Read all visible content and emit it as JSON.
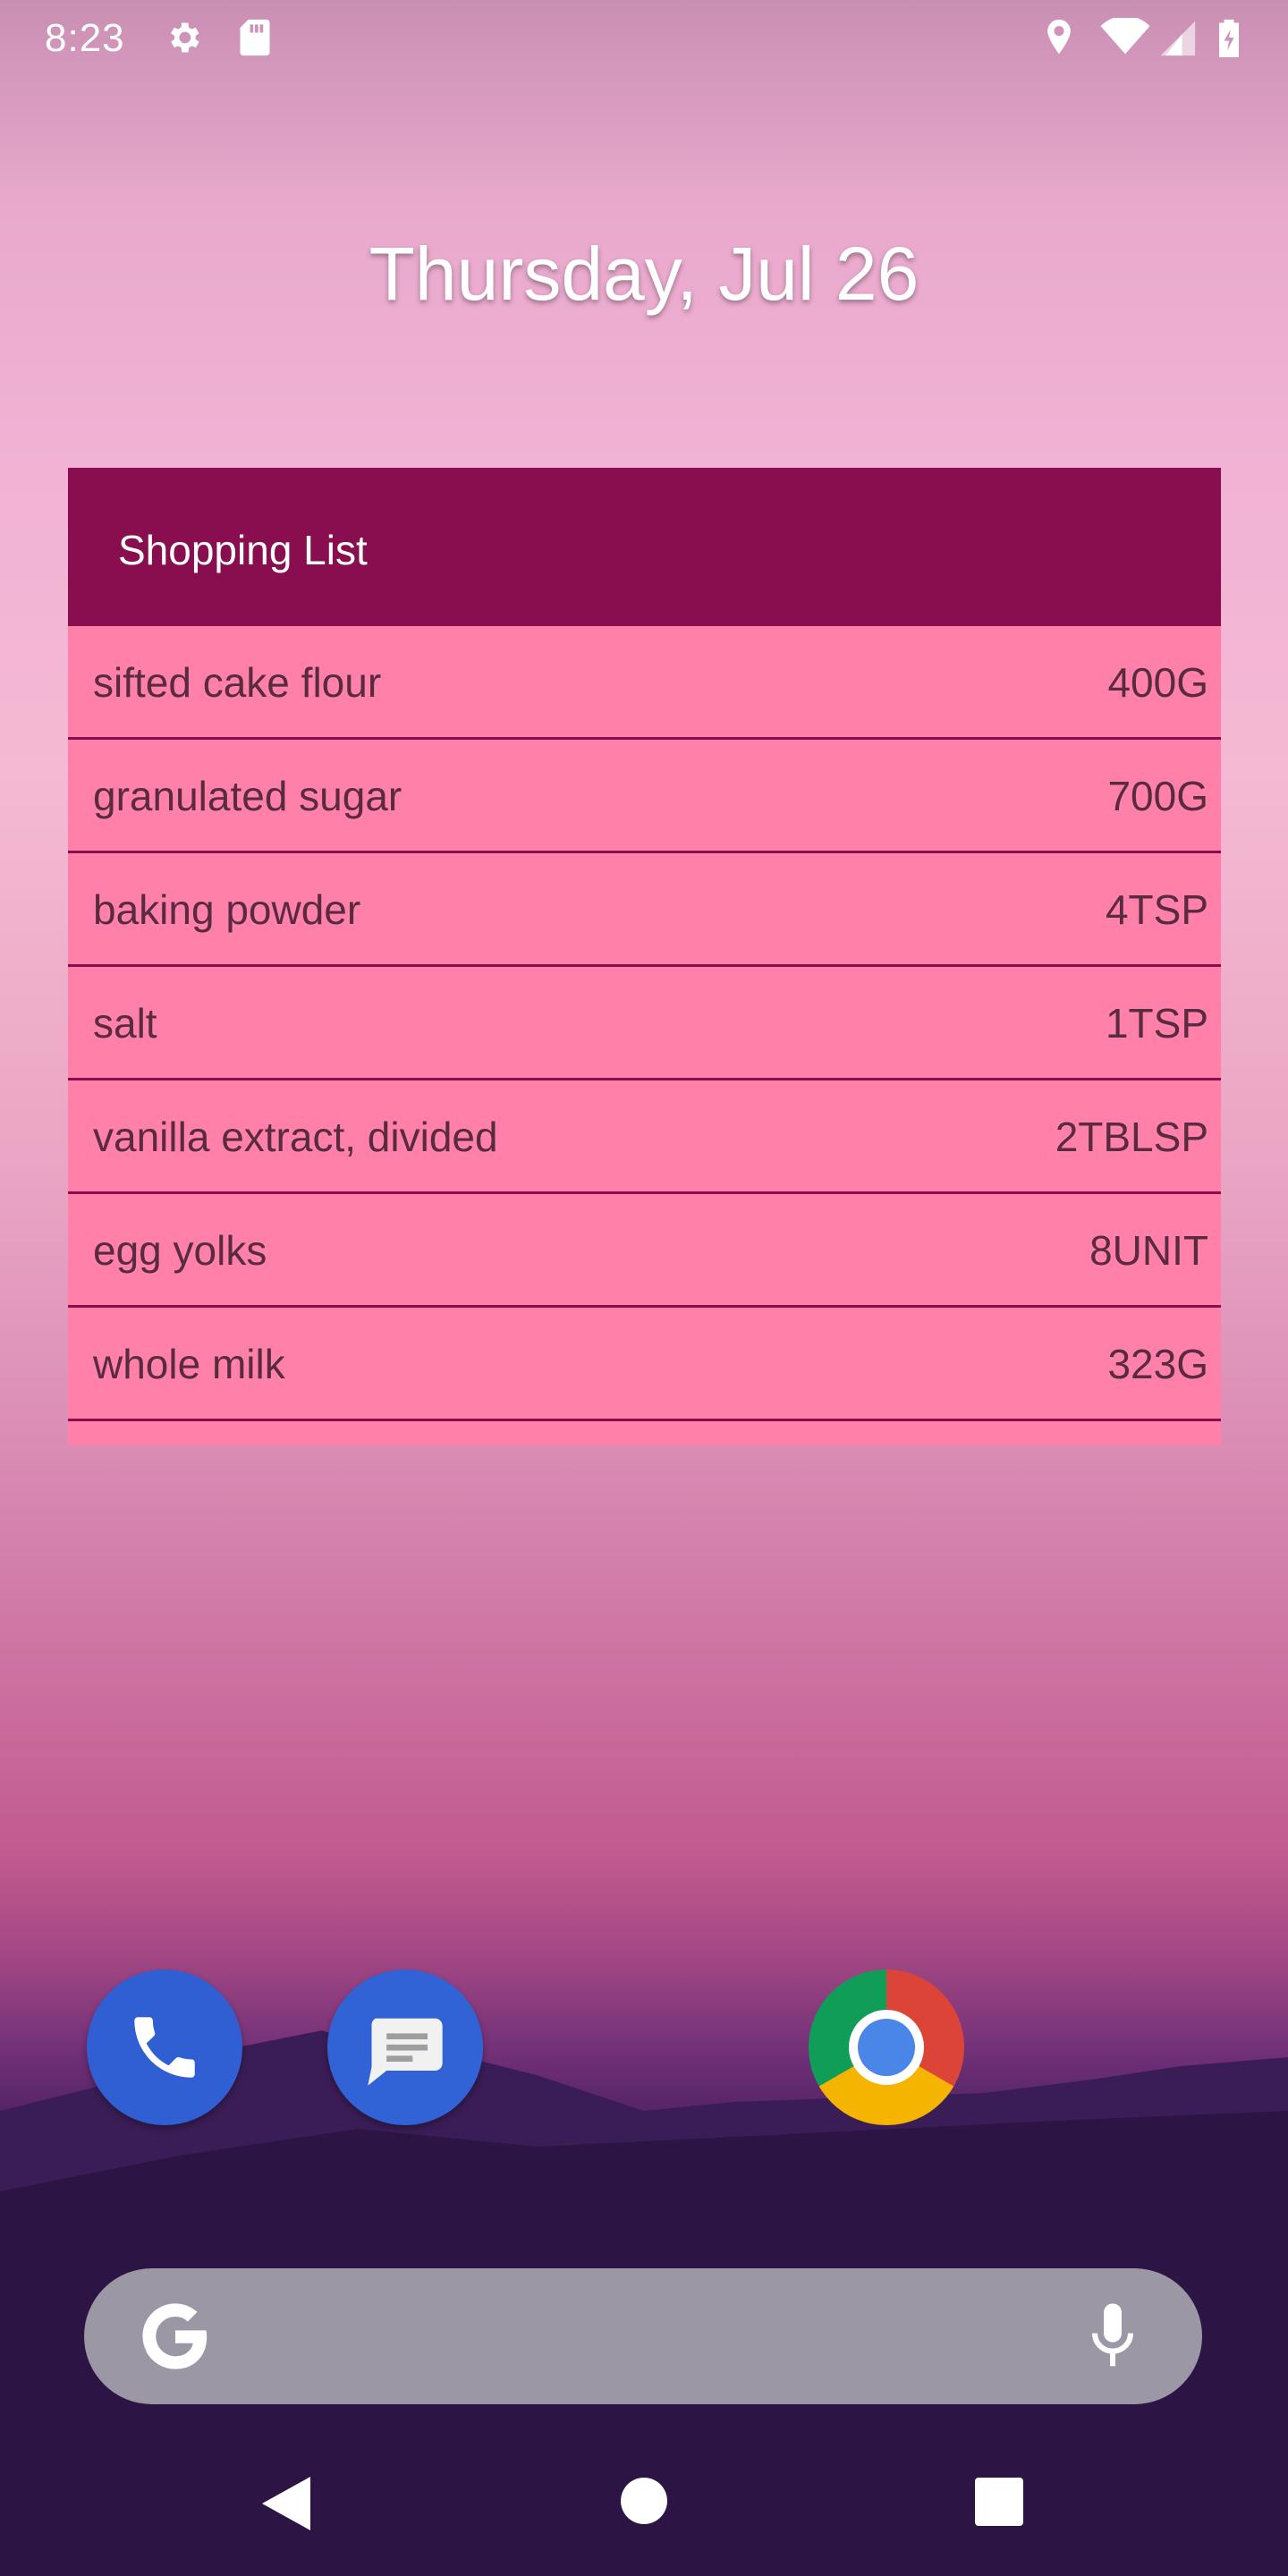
{
  "status_bar": {
    "time": "8:23",
    "left_icons": [
      "gear-icon",
      "sd-card-icon"
    ],
    "right_icons": [
      "location-icon",
      "wifi-icon",
      "signal-icon",
      "battery-charging-icon"
    ]
  },
  "date": "Thursday, Jul 26",
  "widget": {
    "title": "Shopping List",
    "header_color": "#880E4F",
    "row_color": "#FF80A8",
    "items": [
      {
        "name": "sifted cake flour",
        "qty": "400G"
      },
      {
        "name": "granulated sugar",
        "qty": "700G"
      },
      {
        "name": "baking powder",
        "qty": "4TSP"
      },
      {
        "name": "salt",
        "qty": "1TSP"
      },
      {
        "name": "vanilla extract, divided",
        "qty": "2TBLSP"
      },
      {
        "name": "egg yolks",
        "qty": "8UNIT"
      },
      {
        "name": "whole milk",
        "qty": "323G"
      }
    ]
  },
  "dock": {
    "apps": [
      "phone-icon",
      "messages-icon",
      "chrome-icon"
    ]
  },
  "search_bar": {
    "icons": [
      "google-g-icon",
      "mic-icon"
    ]
  },
  "nav_bar": {
    "buttons": [
      "back-icon",
      "home-icon",
      "recents-icon"
    ]
  }
}
